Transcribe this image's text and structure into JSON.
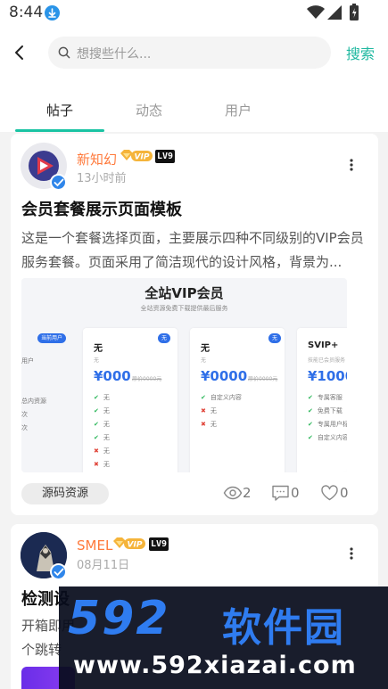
{
  "status_bar": {
    "time": "8:44"
  },
  "header": {
    "search_placeholder": "想搜些什么...",
    "search_button": "搜索"
  },
  "tabs": [
    {
      "label": "帖子",
      "active": true
    },
    {
      "label": "动态",
      "active": false
    },
    {
      "label": "用户",
      "active": false
    }
  ],
  "posts": [
    {
      "author": "新知幻",
      "vip": "VIP",
      "level": "LV9",
      "time": "13小时前",
      "title": "会员套餐展示页面模板",
      "excerpt": "这是一个套餐选择页面，主要展示四种不同级别的VIP会员服务套餐。页面采用了简洁现代的设计风格，背景为...",
      "preview": {
        "title": "全站VIP会员",
        "subtitle": "全站资源免费下载提供最后服务",
        "left_tag": "当前用户",
        "left_items": [
          "用户",
          "总内资源",
          "次",
          "次"
        ],
        "plans": [
          {
            "name": "无",
            "desc": "无",
            "price": "¥000",
            "old_price": "原价0000元",
            "tag": "无",
            "features": [
              {
                "ok": true,
                "text": "无"
              },
              {
                "ok": true,
                "text": "无"
              },
              {
                "ok": true,
                "text": "无"
              },
              {
                "ok": true,
                "text": "无"
              },
              {
                "ok": false,
                "text": "无"
              },
              {
                "ok": false,
                "text": "无"
              }
            ]
          },
          {
            "name": "无",
            "desc": "无",
            "price": "¥0000",
            "old_price": "原价0000元",
            "tag": "无",
            "features": [
              {
                "ok": true,
                "text": "自定义内容"
              },
              {
                "ok": false,
                "text": "无"
              },
              {
                "ok": false,
                "text": "无"
              }
            ]
          },
          {
            "name": "SVIP+",
            "desc": "技能已会员服务",
            "price": "¥1000",
            "old_price": "",
            "tag": "",
            "features": [
              {
                "ok": true,
                "text": "专属客服"
              },
              {
                "ok": true,
                "text": "免费下载"
              },
              {
                "ok": true,
                "text": "专属用户标"
              },
              {
                "ok": true,
                "text": "自定义内容"
              }
            ]
          }
        ]
      },
      "category": "源码资源",
      "views": "2",
      "comments": "0",
      "likes": "0"
    },
    {
      "author": "SMEL",
      "vip": "VIP",
      "level": "LV9",
      "time": "08月11日",
      "title": "检测设",
      "excerpt": "开箱即用\n个跳转"
    }
  ],
  "watermark": {
    "number": "592",
    "name": "软件园",
    "url": "www.592xiazai.com"
  },
  "colors": {
    "accent": "#19c3a3",
    "author": "#ff7a3c",
    "primary_blue": "#2f6fe8"
  }
}
